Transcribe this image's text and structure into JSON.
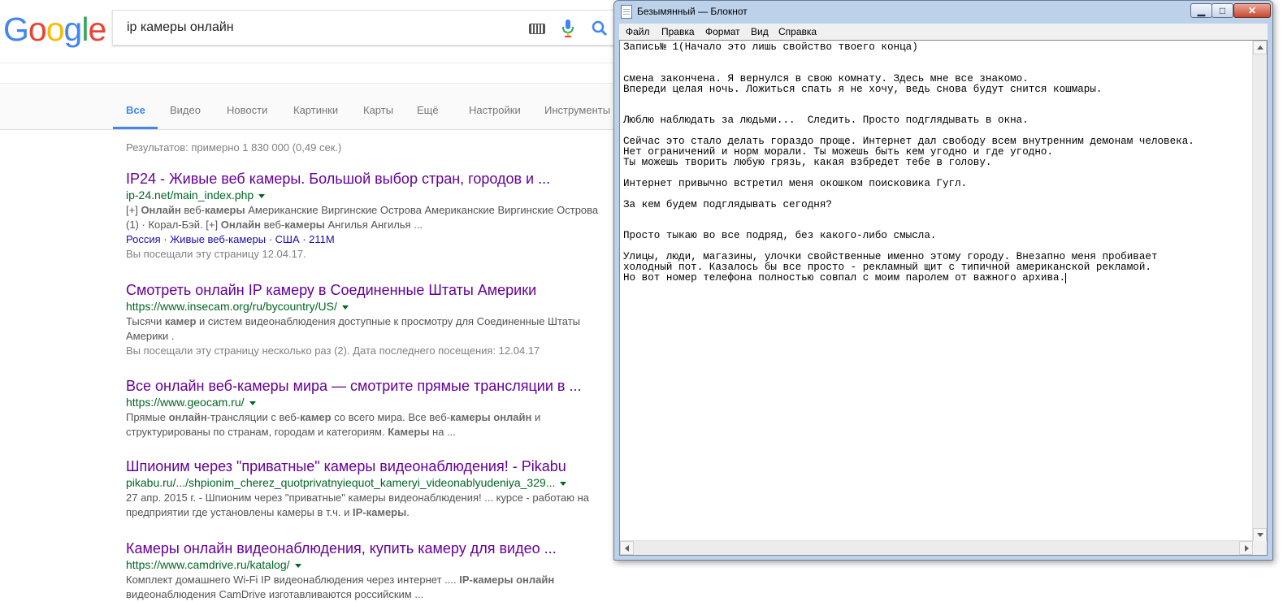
{
  "google": {
    "logo_letters": [
      {
        "ch": "G",
        "color": "#4285f4"
      },
      {
        "ch": "o",
        "color": "#ea4335"
      },
      {
        "ch": "o",
        "color": "#fbbc05"
      },
      {
        "ch": "g",
        "color": "#4285f4"
      },
      {
        "ch": "l",
        "color": "#34a853"
      },
      {
        "ch": "e",
        "color": "#ea4335"
      }
    ],
    "query": "ip камеры онлайн",
    "tabs": [
      "Все",
      "Видео",
      "Новости",
      "Картинки",
      "Карты",
      "Ещё",
      "Настройки",
      "Инструменты"
    ],
    "active_tab": "Все",
    "stats": "Результатов: примерно 1 830 000 (0,49 сек.)",
    "results": [
      {
        "title": "IP24 - Живые веб камеры. Большой выбор стран, городов и ...",
        "url": "ip-24.net/main_index.php",
        "snippet_html": "[+] <b>Онлайн</b> веб-<b>камеры</b> Американские Виргинские Острова Американские Виргинские Острова (1) · Корал-Бэй. [+] <b>Онлайн</b> веб-<b>камеры</b> Ангилья Ангилья ...",
        "links": "Россия · Живые веб-камеры · США · 211M",
        "visited": "Вы посещали эту страницу 12.04.17."
      },
      {
        "title": "Смотреть онлайн IP камеру в Соединенные Штаты Америки",
        "url": "https://www.insecam.org/ru/bycountry/US/",
        "snippet_html": "Тысячи <b>камер</b> и систем видеонаблюдения доступные к просмотру для Соединенные Штаты Америки .",
        "links": "",
        "visited": "Вы посещали эту страницу несколько раз (2). Дата последнего посещения: 12.04.17"
      },
      {
        "title": "Все онлайн веб-камеры мира — смотрите прямые трансляции в ...",
        "url": "https://www.geocam.ru/",
        "snippet_html": "Прямые <b>онлайн</b>-трансляции с веб-<b>камер</b> со всего мира. Все веб-<b>камеры онлайн</b> и структурированы по странам, городам и категориям. <b>Камеры</b> на ...",
        "links": "",
        "visited": ""
      },
      {
        "title": "Шпионим через \"приватные\" камеры видеонаблюдения! - Pikabu",
        "url": "pikabu.ru/.../shpionim_cherez_quotprivatnyiequot_kameryi_videonablyudeniya_329...",
        "snippet_html": "27 апр. 2015 г. - Шпионим через \"приватные\" камеры видеонаблюдения! ... курсе - работаю на предприятии где установлены камеры в т.ч. и <b>IP-камеры</b>.",
        "links": "",
        "visited": ""
      },
      {
        "title": "Камеры онлайн видеонаблюдения, купить камеру для видео ...",
        "url": "https://www.camdrive.ru/katalog/",
        "snippet_html": "Комплект домашнего Wi-Fi IP видеонаблюдения через интернет .... <b>IP-камеры онлайн</b> видеонаблюдения CamDrive изготавливаются российским ...",
        "links": "",
        "visited": ""
      }
    ]
  },
  "notepad": {
    "title": "Безымянный — Блокнот",
    "menu": [
      "Файл",
      "Правка",
      "Формат",
      "Вид",
      "Справка"
    ],
    "text": "Запись№ 1(Начало это лишь свойство твоего конца)\n\n\nсмена закончена. Я вернулся в свою комнату. Здесь мне все знакомо.\nВпереди целая ночь. Ложиться спать я не хочу, ведь снова будут снится кошмары.\n\n\nЛюблю наблюдать за людьми...  Следить. Просто подглядывать в окна.\n\nСейчас это стало делать гораздо проще. Интернет дал свободу всем внутренним демонам человека.\nНет ограничений и норм морали. Ты можешь быть кем угодно и где угодно.\nТы можешь творить любую грязь, какая взбредет тебе в голову.\n\nИнтернет привычно встретил меня окошком поисковика Гугл.\n\nЗа кем будем подглядывать сегодня?\n\n\nПросто тыкаю во все подряд, без какого-либо смысла.\n\nУлицы, люди, магазины, улочки свойственные именно этому городу. Внезапно меня пробивает\nхолодный пот. Казалось бы все просто - рекламный щит с типичной американской рекламой.\nНо вот номер телефона полностью совпал с моим паролем от важного архива."
  }
}
